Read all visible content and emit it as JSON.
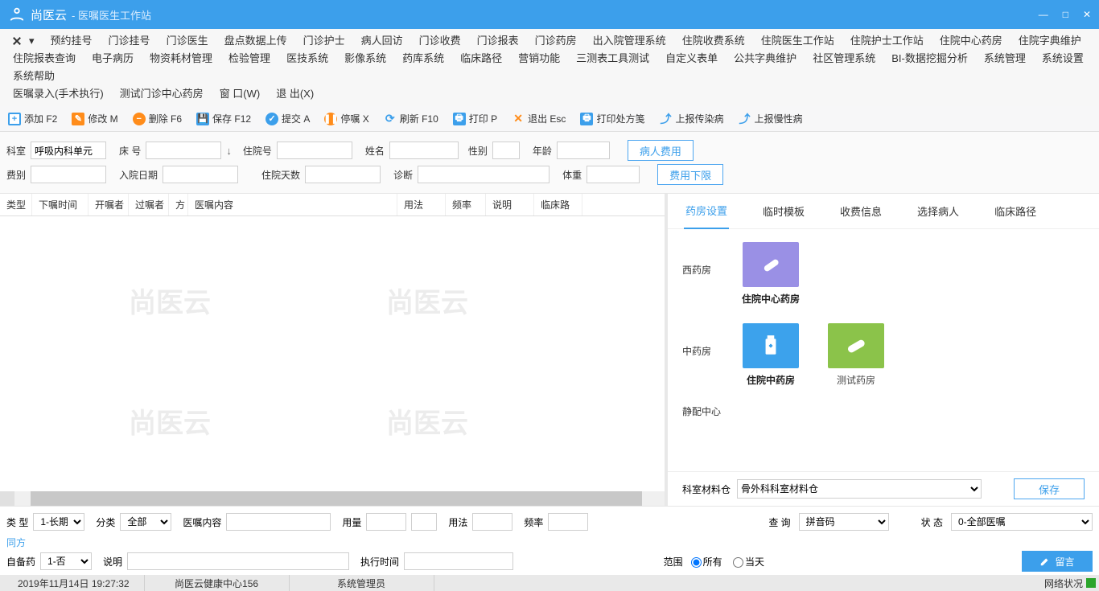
{
  "titlebar": {
    "app": "尚医云",
    "sub": "- 医嘱医生工作站"
  },
  "menubar": {
    "row1": [
      "预约挂号",
      "门诊挂号",
      "门诊医生",
      "盘点数据上传",
      "门诊护士",
      "病人回访",
      "门诊收费",
      "门诊报表",
      "门诊药房",
      "出入院管理系统",
      "住院收费系统",
      "住院医生工作站",
      "住院护士工作站",
      "住院中心药房",
      "住院字典维护"
    ],
    "row2": [
      "住院报表查询",
      "电子病历",
      "物资耗材管理",
      "检验管理",
      "医技系统",
      "影像系统",
      "药库系统",
      "临床路径",
      "营销功能",
      "三测表工具测试",
      "自定义表单",
      "公共字典维护",
      "社区管理系统",
      "BI-数据挖掘分析",
      "系统管理",
      "系统设置",
      "系统帮助"
    ],
    "row3": [
      "医嘱录入(手术执行)",
      "测试门诊中心药房",
      "窗 口(W)",
      "退 出(X)"
    ]
  },
  "toolbar": [
    {
      "icon": "plus",
      "label": "添加 F2"
    },
    {
      "icon": "edit",
      "label": "修改 M"
    },
    {
      "icon": "del",
      "label": "删除 F6"
    },
    {
      "icon": "save",
      "label": "保存 F12"
    },
    {
      "icon": "submit",
      "label": "提交 A"
    },
    {
      "icon": "pause",
      "label": "停嘱 X"
    },
    {
      "icon": "refresh",
      "label": "刷新 F10"
    },
    {
      "icon": "print",
      "label": "打印 P"
    },
    {
      "icon": "exit",
      "label": "退出 Esc"
    },
    {
      "icon": "prescript",
      "label": "打印处方笺"
    },
    {
      "icon": "upload",
      "label": "上报传染病"
    },
    {
      "icon": "upload",
      "label": "上报慢性病"
    }
  ],
  "form": {
    "dept_label": "科室",
    "dept_value": "呼吸内科单元",
    "bed_label": "床 号",
    "hosp_no_label": "住院号",
    "name_label": "姓名",
    "gender_label": "性别",
    "age_label": "年龄",
    "patient_fee_btn": "病人费用",
    "fee_type_label": "费别",
    "in_date_label": "入院日期",
    "in_days_label": "住院天数",
    "diag_label": "诊断",
    "weight_label": "体重",
    "fee_limit_btn": "费用下限"
  },
  "grid_headers": [
    "类型",
    "下嘱时间",
    "开嘱者",
    "过嘱者",
    "方",
    "医嘱内容",
    "用法",
    "频率",
    "说明",
    "临床路"
  ],
  "rtabs": [
    "药房设置",
    "临时模板",
    "收费信息",
    "选择病人",
    "临床路径"
  ],
  "pharm": {
    "row1": {
      "label": "西药房",
      "cards": [
        {
          "name": "住院中心药房",
          "color": "purple"
        }
      ]
    },
    "row2": {
      "label": "中药房",
      "cards": [
        {
          "name": "住院中药房",
          "color": "blue"
        },
        {
          "name": "测试药房",
          "color": "green",
          "thin": true
        }
      ]
    },
    "row3": {
      "label": "静配中心"
    }
  },
  "rfoot": {
    "label": "科室材料仓",
    "option": "骨外科科室材料仓",
    "btn": "保存"
  },
  "bottom": {
    "type_label": "类 型",
    "type_val": "1-长期",
    "class_label": "分类",
    "class_val": "全部",
    "content_label": "医嘱内容",
    "usage_amt_label": "用量",
    "usage_label": "用法",
    "freq_label": "频率",
    "tongfang": "同方",
    "selfdrug_label": "自备药",
    "selfdrug_val": "1-否",
    "desc_label": "说明",
    "exec_time_label": "执行时间",
    "query_label": "查 询",
    "query_val": "拼音码",
    "state_label": "状 态",
    "state_val": "0-全部医嘱",
    "range_label": "范围",
    "range_all": "所有",
    "range_today": "当天",
    "msg_btn": "留言"
  },
  "status": {
    "time": "2019年11月14日 19:27:32",
    "center": "尚医云健康中心156",
    "admin": "系统管理员",
    "net": "网络状况"
  }
}
